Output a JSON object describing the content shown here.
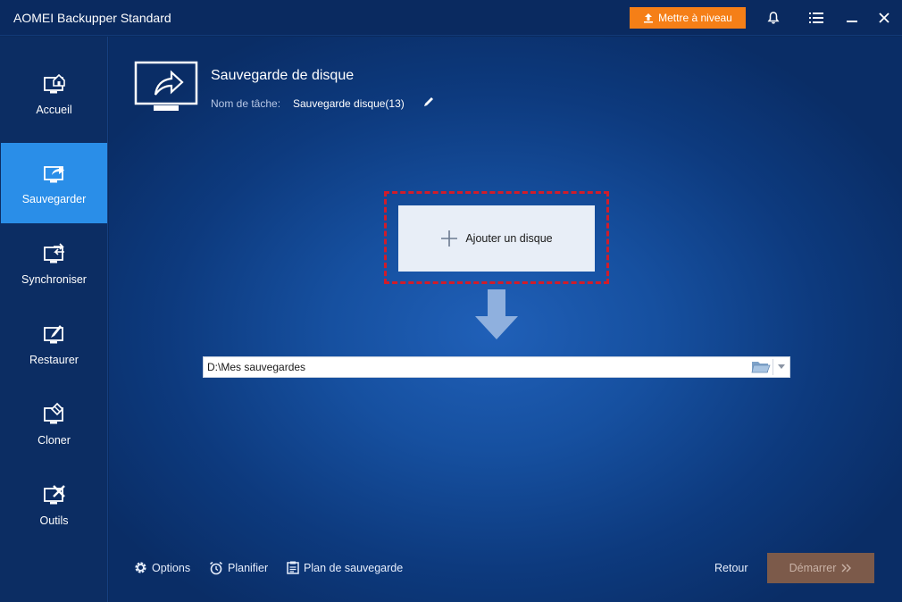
{
  "app": {
    "title": "AOMEI Backupper Standard"
  },
  "titlebar": {
    "upgrade_label": "Mettre à niveau"
  },
  "sidebar": {
    "items": [
      {
        "label": "Accueil",
        "icon": "home-icon",
        "active": false
      },
      {
        "label": "Sauvegarder",
        "icon": "backup-icon",
        "active": true
      },
      {
        "label": "Synchroniser",
        "icon": "sync-icon",
        "active": false
      },
      {
        "label": "Restaurer",
        "icon": "restore-icon",
        "active": false
      },
      {
        "label": "Cloner",
        "icon": "clone-icon",
        "active": false
      },
      {
        "label": "Outils",
        "icon": "tools-icon",
        "active": false
      }
    ]
  },
  "main": {
    "title": "Sauvegarde de disque",
    "task_name_label": "Nom de tâche:",
    "task_name_value": "Sauvegarde disque(13)",
    "add_disk_label": "Ajouter un disque",
    "destination_value": "D:\\Mes sauvegardes"
  },
  "bottom": {
    "options_label": "Options",
    "schedule_label": "Planifier",
    "plan_label": "Plan de sauvegarde",
    "back_label": "Retour",
    "start_label": "Démarrer"
  },
  "colors": {
    "accent": "#2a8ee8",
    "upgrade": "#f57f17",
    "highlight_frame": "#d11c2a",
    "start_disabled": "#7c5a4a"
  }
}
